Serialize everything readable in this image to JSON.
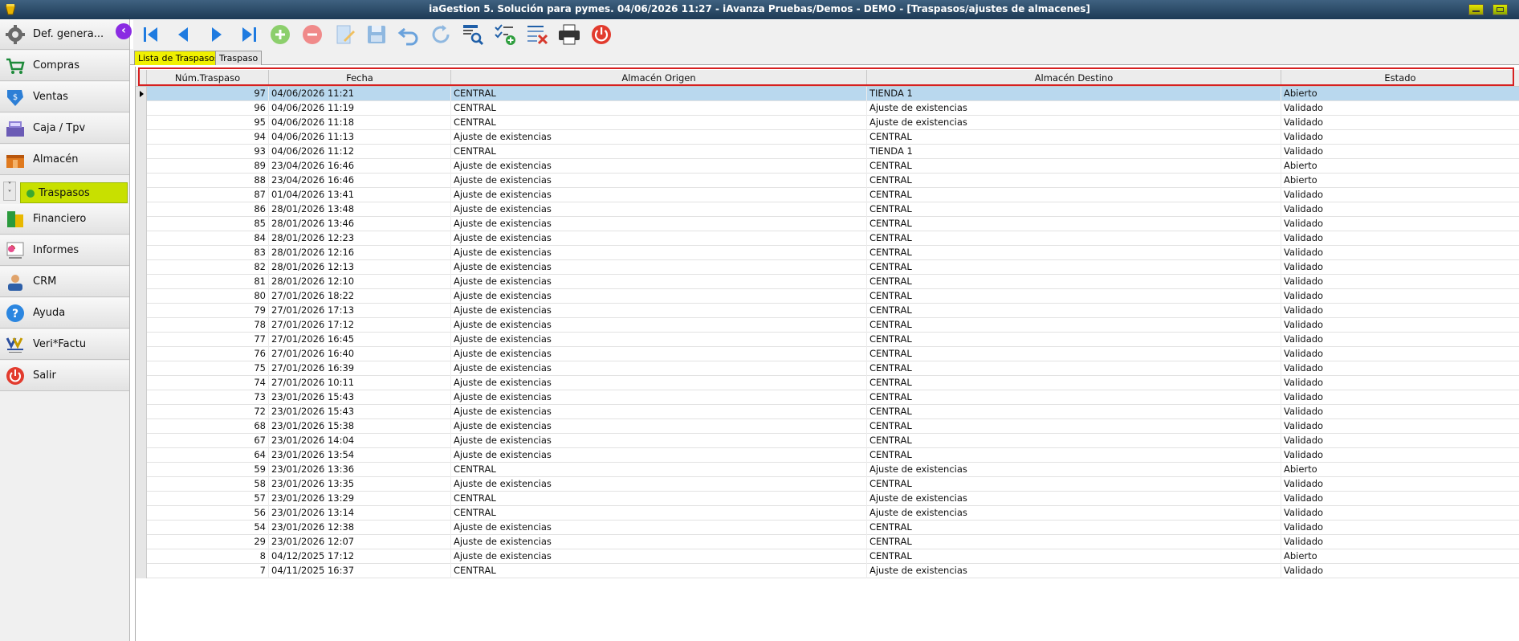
{
  "window": {
    "title": "iaGestion 5. Solución para pymes.  04/06/2026 11:27  -  iAvanza Pruebas/Demos - DEMO - [Traspasos/ajustes de almacenes]"
  },
  "sidebar": {
    "items": [
      {
        "label": "Def. genera...",
        "icon": "gear-icon"
      },
      {
        "label": "Compras",
        "icon": "cart-icon"
      },
      {
        "label": "Ventas",
        "icon": "sales-icon"
      },
      {
        "label": "Caja / Tpv",
        "icon": "cash-register-icon"
      },
      {
        "label": "Almacén",
        "icon": "warehouse-icon"
      },
      {
        "label": "Financiero",
        "icon": "money-icon"
      },
      {
        "label": "Informes",
        "icon": "report-icon"
      },
      {
        "label": "CRM",
        "icon": "user-icon"
      },
      {
        "label": "Ayuda",
        "icon": "help-icon"
      },
      {
        "label": "Veri*Factu",
        "icon": "verifactu-logo-icon"
      },
      {
        "label": "Salir",
        "icon": "power-icon"
      }
    ],
    "sub_item": {
      "label": "Traspasos"
    }
  },
  "tabs": [
    {
      "label": "Lista de Traspasos",
      "active": true
    },
    {
      "label": "Traspaso",
      "active": false
    }
  ],
  "grid": {
    "columns": [
      "Núm.Traspaso",
      "Fecha",
      "Almacén Origen",
      "Almacén Destino",
      "Estado"
    ],
    "rows": [
      [
        "97",
        "04/06/2026 11:21",
        "CENTRAL",
        "TIENDA 1",
        "Abierto"
      ],
      [
        "96",
        "04/06/2026 11:19",
        "CENTRAL",
        "Ajuste de existencias",
        "Validado"
      ],
      [
        "95",
        "04/06/2026 11:18",
        "CENTRAL",
        "Ajuste de existencias",
        "Validado"
      ],
      [
        "94",
        "04/06/2026 11:13",
        "Ajuste de existencias",
        "CENTRAL",
        "Validado"
      ],
      [
        "93",
        "04/06/2026 11:12",
        "CENTRAL",
        "TIENDA 1",
        "Validado"
      ],
      [
        "89",
        "23/04/2026 16:46",
        "Ajuste de existencias",
        "CENTRAL",
        "Abierto"
      ],
      [
        "88",
        "23/04/2026 16:46",
        "Ajuste de existencias",
        "CENTRAL",
        "Abierto"
      ],
      [
        "87",
        "01/04/2026 13:41",
        "Ajuste de existencias",
        "CENTRAL",
        "Validado"
      ],
      [
        "86",
        "28/01/2026 13:48",
        "Ajuste de existencias",
        "CENTRAL",
        "Validado"
      ],
      [
        "85",
        "28/01/2026 13:46",
        "Ajuste de existencias",
        "CENTRAL",
        "Validado"
      ],
      [
        "84",
        "28/01/2026 12:23",
        "Ajuste de existencias",
        "CENTRAL",
        "Validado"
      ],
      [
        "83",
        "28/01/2026 12:16",
        "Ajuste de existencias",
        "CENTRAL",
        "Validado"
      ],
      [
        "82",
        "28/01/2026 12:13",
        "Ajuste de existencias",
        "CENTRAL",
        "Validado"
      ],
      [
        "81",
        "28/01/2026 12:10",
        "Ajuste de existencias",
        "CENTRAL",
        "Validado"
      ],
      [
        "80",
        "27/01/2026 18:22",
        "Ajuste de existencias",
        "CENTRAL",
        "Validado"
      ],
      [
        "79",
        "27/01/2026 17:13",
        "Ajuste de existencias",
        "CENTRAL",
        "Validado"
      ],
      [
        "78",
        "27/01/2026 17:12",
        "Ajuste de existencias",
        "CENTRAL",
        "Validado"
      ],
      [
        "77",
        "27/01/2026 16:45",
        "Ajuste de existencias",
        "CENTRAL",
        "Validado"
      ],
      [
        "76",
        "27/01/2026 16:40",
        "Ajuste de existencias",
        "CENTRAL",
        "Validado"
      ],
      [
        "75",
        "27/01/2026 16:39",
        "Ajuste de existencias",
        "CENTRAL",
        "Validado"
      ],
      [
        "74",
        "27/01/2026 10:11",
        "Ajuste de existencias",
        "CENTRAL",
        "Validado"
      ],
      [
        "73",
        "23/01/2026 15:43",
        "Ajuste de existencias",
        "CENTRAL",
        "Validado"
      ],
      [
        "72",
        "23/01/2026 15:43",
        "Ajuste de existencias",
        "CENTRAL",
        "Validado"
      ],
      [
        "68",
        "23/01/2026 15:38",
        "Ajuste de existencias",
        "CENTRAL",
        "Validado"
      ],
      [
        "67",
        "23/01/2026 14:04",
        "Ajuste de existencias",
        "CENTRAL",
        "Validado"
      ],
      [
        "64",
        "23/01/2026 13:54",
        "Ajuste de existencias",
        "CENTRAL",
        "Validado"
      ],
      [
        "59",
        "23/01/2026 13:36",
        "CENTRAL",
        "Ajuste de existencias",
        "Abierto"
      ],
      [
        "58",
        "23/01/2026 13:35",
        "Ajuste de existencias",
        "CENTRAL",
        "Validado"
      ],
      [
        "57",
        "23/01/2026 13:29",
        "CENTRAL",
        "Ajuste de existencias",
        "Validado"
      ],
      [
        "56",
        "23/01/2026 13:14",
        "CENTRAL",
        "Ajuste de existencias",
        "Validado"
      ],
      [
        "54",
        "23/01/2026 12:38",
        "Ajuste de existencias",
        "CENTRAL",
        "Validado"
      ],
      [
        "29",
        "23/01/2026 12:07",
        "Ajuste de existencias",
        "CENTRAL",
        "Validado"
      ],
      [
        "8",
        "04/12/2025 17:12",
        "Ajuste de existencias",
        "CENTRAL",
        "Abierto"
      ],
      [
        "7",
        "04/11/2025 16:37",
        "CENTRAL",
        "Ajuste de existencias",
        "Validado"
      ]
    ],
    "selected_row": 0
  },
  "colors": {
    "accent_yellow": "#f0f000",
    "selected_row": "#b9d8ee",
    "highlight_red": "#d62020",
    "collapse_purple": "#8a2be2"
  }
}
